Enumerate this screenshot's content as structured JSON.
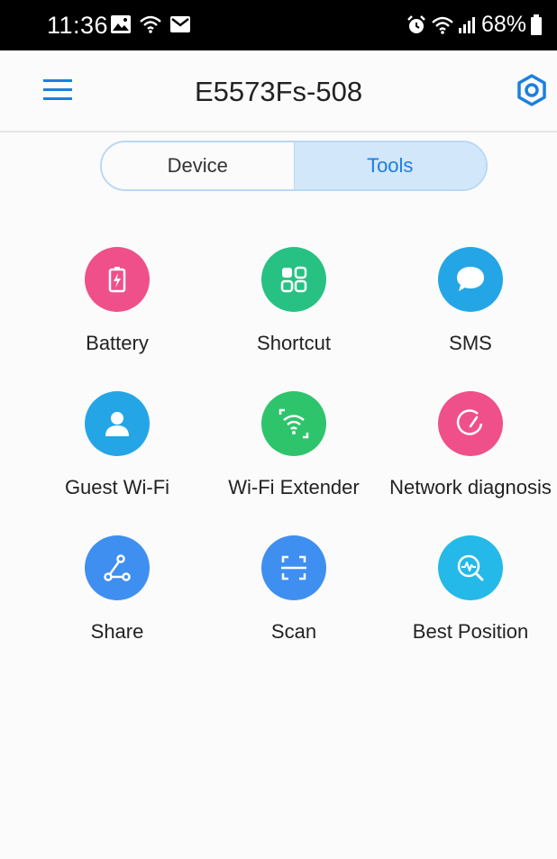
{
  "status_bar": {
    "time": "11:36",
    "battery_percent": "68%"
  },
  "header": {
    "title": "E5573Fs-508",
    "menu_icon": "hamburger-menu-icon",
    "settings_icon": "gear-icon"
  },
  "tabs": [
    {
      "label": "Device",
      "selected": false
    },
    {
      "label": "Tools",
      "selected": true
    }
  ],
  "tools": [
    {
      "label": "Battery",
      "icon": "battery-icon",
      "color": "#f0508a"
    },
    {
      "label": "Shortcut",
      "icon": "shortcut-grid-icon",
      "color": "#27c183"
    },
    {
      "label": "SMS",
      "icon": "chat-bubble-icon",
      "color": "#24a6e6"
    },
    {
      "label": "Guest Wi-Fi",
      "icon": "guest-user-icon",
      "color": "#24a6e6"
    },
    {
      "label": "Wi-Fi Extender",
      "icon": "wifi-extender-icon",
      "color": "#2ec46c"
    },
    {
      "label": "Network diagnosis",
      "icon": "diagnosis-gauge-icon",
      "color": "#f0508a"
    },
    {
      "label": "Share",
      "icon": "share-icon",
      "color": "#3f8ff0"
    },
    {
      "label": "Scan",
      "icon": "scan-icon",
      "color": "#3f8ff0"
    },
    {
      "label": "Best Position",
      "icon": "signal-search-icon",
      "color": "#24b9e8"
    }
  ],
  "colors": {
    "accent": "#1c7fe0",
    "status_bar": "#000000"
  }
}
